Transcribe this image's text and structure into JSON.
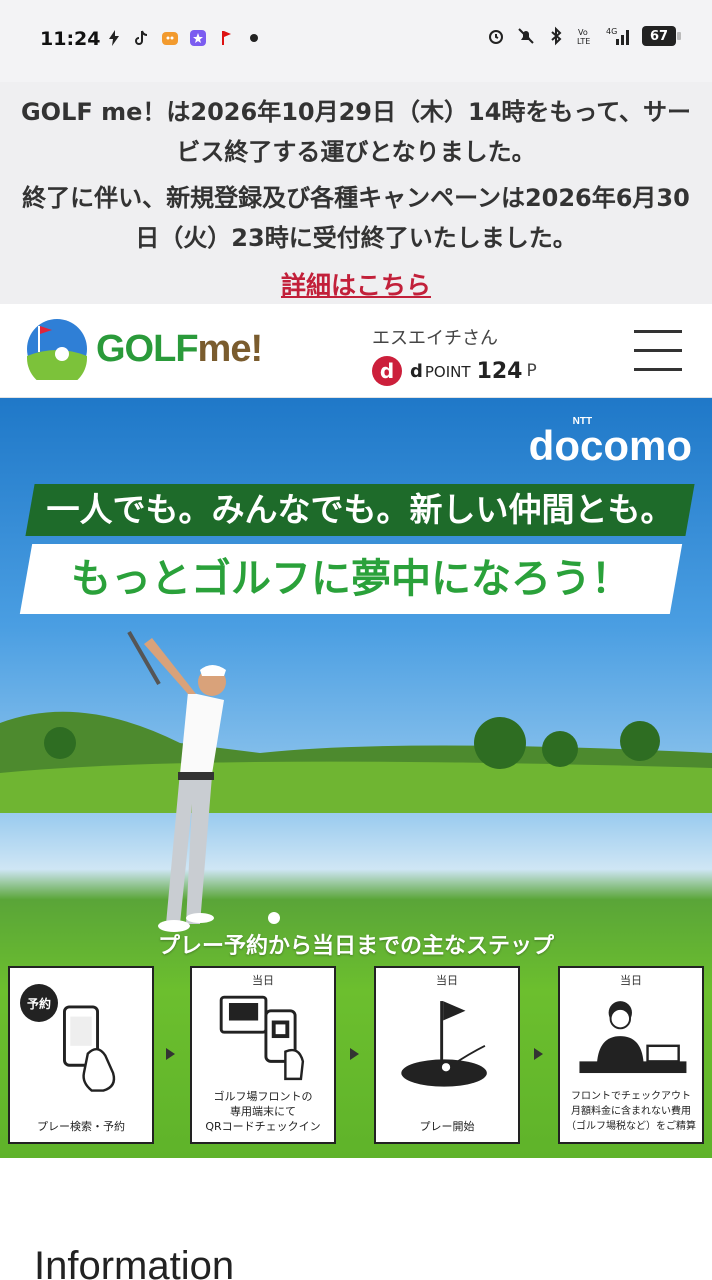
{
  "status_bar": {
    "time": "11:24",
    "battery": "67",
    "network": "4G"
  },
  "notice": {
    "line1": "GOLF me！は2026年10月29日（木）14時をもって、サービス終了する運びとなりました。",
    "line2": "終了に伴い、新規登録及び各種キャンペーンは2026年6月30日（火）23時に受付終了いたしました。",
    "link": "詳細はこちら"
  },
  "header": {
    "logo_golf": "GOLF",
    "logo_me": "me!",
    "user_name": "エスエイチさん",
    "dpoint_mark": "d",
    "dpoint_label": "d",
    "dpoint_word": "POINT",
    "points": "124",
    "points_unit": "P"
  },
  "hero": {
    "brand_small": "NTT",
    "brand": "docomo",
    "tagline1": "一人でも。みんなでも。新しい仲間とも。",
    "tagline2": "もっとゴルフに夢中になろう！",
    "steps_title": "プレー予約から当日までの主なステップ",
    "steps": [
      {
        "badge": "予約",
        "day": "",
        "label": "プレー検索・予約"
      },
      {
        "badge": "",
        "day": "当日",
        "label": "ゴルフ場フロントの\n専用端末にて\nQRコードチェックイン"
      },
      {
        "badge": "",
        "day": "当日",
        "label": "プレー開始"
      },
      {
        "badge": "",
        "day": "当日",
        "label": "フロントでチェックアウト\n月額料金に含まれない費用\n（ゴルフ場税など）をご精算"
      }
    ]
  },
  "info": {
    "title": "Information"
  },
  "colors": {
    "accent_red": "#c2203a",
    "brand_green": "#2a9a3a"
  }
}
